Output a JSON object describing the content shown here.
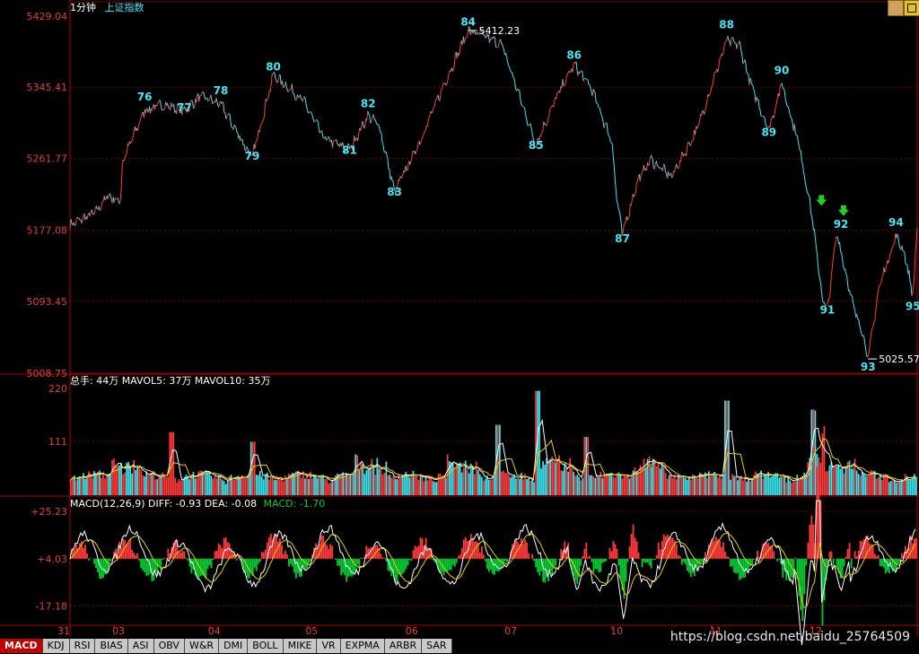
{
  "header": {
    "period": "1分钟",
    "index_name": "上证指数"
  },
  "colors": {
    "bg": "#000000",
    "grid": "#7a0000",
    "axis_text": "#e23c3c",
    "up": "#ff3a3a",
    "down": "#3ae6f0",
    "label": "#40e8f8",
    "arrow": "#22cc22",
    "white": "#ffffff",
    "yellow": "#e8d000",
    "macd_green": "#00cc33"
  },
  "price_panel": {
    "y_ticks": [
      "5429.04",
      "5345.41",
      "5261.77",
      "5177.08",
      "5093.45",
      "5008.75"
    ],
    "high_mark": "5412.23",
    "low_mark": "5025.57",
    "wave_labels": [
      {
        "text": "76",
        "price": 5330,
        "t": 0.088
      },
      {
        "text": "77",
        "price": 5317,
        "t": 0.135
      },
      {
        "text": "78",
        "price": 5337,
        "t": 0.178
      },
      {
        "text": "79",
        "price": 5260,
        "t": 0.215
      },
      {
        "text": "80",
        "price": 5365,
        "t": 0.24
      },
      {
        "text": "81",
        "price": 5267,
        "t": 0.33
      },
      {
        "text": "82",
        "price": 5322,
        "t": 0.352
      },
      {
        "text": "83",
        "price": 5218,
        "t": 0.383
      },
      {
        "text": "84",
        "price": 5418,
        "t": 0.47
      },
      {
        "text": "85",
        "price": 5273,
        "t": 0.55
      },
      {
        "text": "86",
        "price": 5379,
        "t": 0.595
      },
      {
        "text": "87",
        "price": 5163,
        "t": 0.652
      },
      {
        "text": "88",
        "price": 5415,
        "t": 0.775
      },
      {
        "text": "89",
        "price": 5288,
        "t": 0.825
      },
      {
        "text": "90",
        "price": 5361,
        "t": 0.84
      },
      {
        "text": "91",
        "price": 5079,
        "t": 0.894
      },
      {
        "text": "92",
        "price": 5180,
        "t": 0.91
      },
      {
        "text": "93",
        "price": 5012,
        "t": 0.942
      },
      {
        "text": "94",
        "price": 5182,
        "t": 0.975
      },
      {
        "text": "95",
        "price": 5083,
        "t": 0.995
      }
    ],
    "arrows": [
      {
        "t": 0.887,
        "price": 5210
      },
      {
        "t": 0.913,
        "price": 5198
      }
    ]
  },
  "volume_panel": {
    "legend": "总手: 44万 MAVOL5: 37万 MAVOL10: 35万",
    "y_ticks": [
      "220",
      "111"
    ]
  },
  "macd_panel": {
    "legend_main": "MACD(12,26,9) DIFF: -0.93 DEA: -0.08",
    "legend_macd": "MACD: -1.70",
    "y_ticks": [
      "+25.23",
      "+4.03",
      "-17.18"
    ]
  },
  "x_axis": {
    "labels": [
      "31",
      "03",
      "04",
      "05",
      "06",
      "07",
      "10",
      "11",
      "12"
    ]
  },
  "chart_data": {
    "type": "line",
    "price_range": [
      5008.75,
      5429.04
    ],
    "volume_range": [
      0,
      220
    ],
    "macd_range": [
      -25,
      25.23
    ],
    "days": [
      "31",
      "03",
      "04",
      "05",
      "06",
      "07",
      "10",
      "11",
      "12"
    ],
    "price_waypoints": [
      [
        0.0,
        5183
      ],
      [
        0.03,
        5198
      ],
      [
        0.045,
        5218
      ],
      [
        0.055,
        5212
      ],
      [
        0.06,
        5214
      ],
      [
        0.062,
        5258
      ],
      [
        0.088,
        5318
      ],
      [
        0.11,
        5325
      ],
      [
        0.135,
        5318
      ],
      [
        0.155,
        5335
      ],
      [
        0.178,
        5325
      ],
      [
        0.215,
        5262
      ],
      [
        0.24,
        5360
      ],
      [
        0.275,
        5330
      ],
      [
        0.3,
        5285
      ],
      [
        0.33,
        5272
      ],
      [
        0.352,
        5312
      ],
      [
        0.365,
        5300
      ],
      [
        0.383,
        5222
      ],
      [
        0.41,
        5275
      ],
      [
        0.44,
        5345
      ],
      [
        0.47,
        5412
      ],
      [
        0.49,
        5405
      ],
      [
        0.51,
        5395
      ],
      [
        0.55,
        5278
      ],
      [
        0.575,
        5335
      ],
      [
        0.595,
        5372
      ],
      [
        0.615,
        5345
      ],
      [
        0.64,
        5280
      ],
      [
        0.645,
        5218
      ],
      [
        0.652,
        5172
      ],
      [
        0.67,
        5235
      ],
      [
        0.685,
        5260
      ],
      [
        0.71,
        5240
      ],
      [
        0.74,
        5295
      ],
      [
        0.775,
        5400
      ],
      [
        0.79,
        5395
      ],
      [
        0.805,
        5345
      ],
      [
        0.825,
        5295
      ],
      [
        0.84,
        5350
      ],
      [
        0.86,
        5280
      ],
      [
        0.875,
        5200
      ],
      [
        0.888,
        5098
      ],
      [
        0.894,
        5082
      ],
      [
        0.905,
        5175
      ],
      [
        0.915,
        5130
      ],
      [
        0.925,
        5085
      ],
      [
        0.935,
        5060
      ],
      [
        0.942,
        5025
      ],
      [
        0.955,
        5110
      ],
      [
        0.975,
        5170
      ],
      [
        0.985,
        5150
      ],
      [
        0.995,
        5100
      ],
      [
        1.0,
        5180
      ]
    ],
    "volume_spikes": [
      {
        "t": 0.12,
        "value": 130
      },
      {
        "t": 0.215,
        "value": 110
      },
      {
        "t": 0.505,
        "value": 145
      },
      {
        "t": 0.552,
        "value": 215
      },
      {
        "t": 0.61,
        "value": 120
      },
      {
        "t": 0.776,
        "value": 195
      },
      {
        "t": 0.878,
        "value": 150
      },
      {
        "t": 0.89,
        "value": 110
      }
    ],
    "volume_base": 22,
    "volume_mavol_level": 45,
    "macd_hist_scale": 14,
    "macd_diff_dips": [
      {
        "t": 0.6,
        "value": -15
      },
      {
        "t": 0.655,
        "value": -28
      },
      {
        "t": 0.866,
        "value": -40
      },
      {
        "t": 0.888,
        "value": -22
      },
      {
        "t": 0.912,
        "value": -15
      }
    ]
  },
  "tabs": [
    "MACD",
    "KDJ",
    "RSI",
    "BIAS",
    "ASI",
    "OBV",
    "W&R",
    "DMI",
    "BOLL",
    "MIKE",
    "VR",
    "EXPMA",
    "ARBR",
    "SAR"
  ],
  "watermark": "https://blog.csdn.net/baidu_25764509"
}
